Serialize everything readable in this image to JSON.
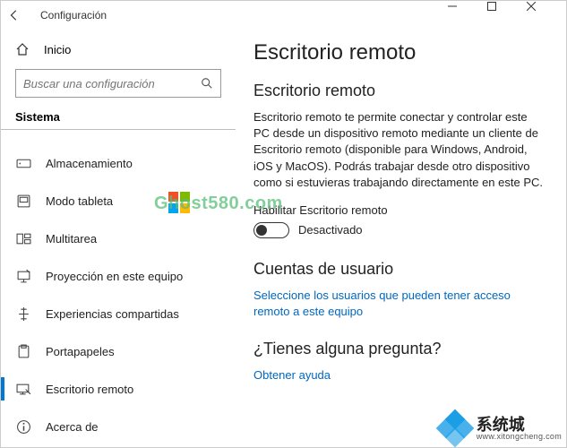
{
  "titlebar": {
    "title": "Configuración"
  },
  "sidebar": {
    "home_label": "Inicio",
    "search_placeholder": "Buscar una configuración",
    "section": "Sistema",
    "items": [
      {
        "label": "Almacenamiento"
      },
      {
        "label": "Modo tableta"
      },
      {
        "label": "Multitarea"
      },
      {
        "label": "Proyección en este equipo"
      },
      {
        "label": "Experiencias compartidas"
      },
      {
        "label": "Portapapeles"
      },
      {
        "label": "Escritorio remoto"
      },
      {
        "label": "Acerca de"
      }
    ]
  },
  "main": {
    "page_title": "Escritorio remoto",
    "section1_title": "Escritorio remoto",
    "section1_body": "Escritorio remoto te permite conectar y controlar este PC desde un dispositivo remoto mediante un cliente de Escritorio remoto (disponible para Windows, Android, iOS y MacOS). Podrás trabajar desde otro dispositivo como si estuvieras trabajando directamente en este PC.",
    "toggle_label": "Habilitar Escritorio remoto",
    "toggle_state": "Desactivado",
    "section2_title": "Cuentas de usuario",
    "section2_link": "Seleccione los usuarios que pueden tener acceso remoto a este equipo",
    "section3_title": "¿Tienes alguna pregunta?",
    "section3_link": "Obtener ayuda"
  },
  "watermark": {
    "text": "Ghost580.com"
  },
  "brand": {
    "name": "系统城",
    "url": "www.xitongcheng.com"
  }
}
